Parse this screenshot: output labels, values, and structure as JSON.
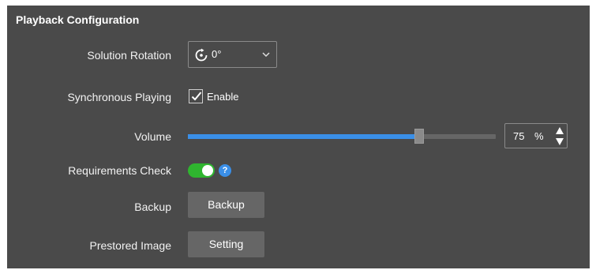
{
  "panel": {
    "title": "Playback Configuration"
  },
  "rotation": {
    "label": "Solution Rotation",
    "value": "0°",
    "icon": "rotate-icon"
  },
  "sync": {
    "label": "Synchronous Playing",
    "checkbox_label": "Enable",
    "checked": true
  },
  "volume": {
    "label": "Volume",
    "value": "75",
    "unit": "%",
    "level": 0.75
  },
  "requirements": {
    "label": "Requirements Check",
    "enabled": true,
    "help_icon": "help-icon",
    "help_symbol": "?"
  },
  "backup": {
    "label": "Backup",
    "button_label": "Backup"
  },
  "prestored": {
    "label": "Prestored Image",
    "button_label": "Setting"
  },
  "colors": {
    "panel_bg": "#4a4a4a",
    "accent": "#3a8fe8",
    "toggle_on": "#2fb52f",
    "button_bg": "#666666"
  }
}
